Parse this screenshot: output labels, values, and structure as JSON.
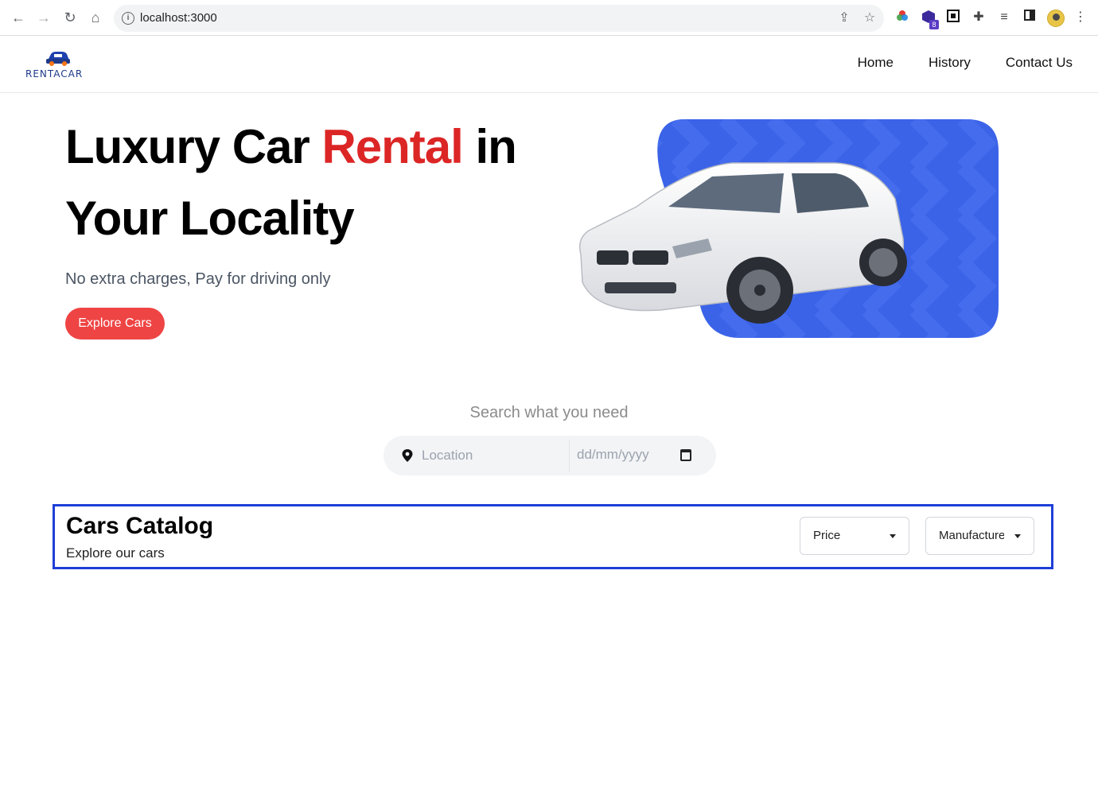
{
  "browser": {
    "url": "localhost:3000",
    "extension_badge": "8"
  },
  "header": {
    "logo_text": "RENTACAR",
    "nav": [
      {
        "label": "Home"
      },
      {
        "label": "History"
      },
      {
        "label": "Contact Us"
      }
    ]
  },
  "hero": {
    "title_part1": "Luxury Car ",
    "title_accent": "Rental",
    "title_part2": " in Your Locality",
    "subtitle": "No extra charges, Pay for driving only",
    "cta_label": "Explore Cars",
    "accent_color": "#dc2626",
    "image_backdrop_color": "#3b63e8"
  },
  "search": {
    "title": "Search what you need",
    "location_placeholder": "Location",
    "date_placeholder": "dd/mm/yyyy"
  },
  "catalog": {
    "title": "Cars Catalog",
    "subtitle": "Explore our cars",
    "filters": [
      {
        "label": "Price"
      },
      {
        "label": "Manufacturer"
      }
    ],
    "highlight_color": "#1d3fd8"
  }
}
